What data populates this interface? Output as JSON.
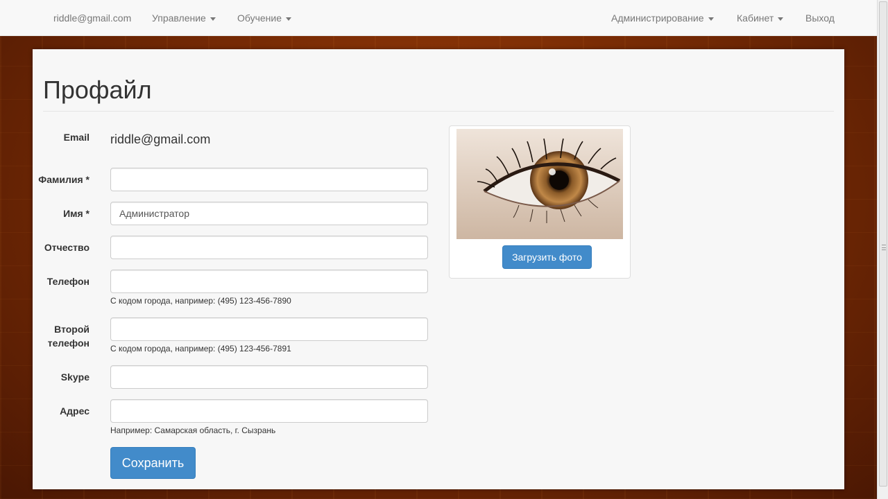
{
  "navbar": {
    "user_email": "riddle@gmail.com",
    "management": "Управление",
    "learning": "Обучение",
    "administration": "Администрирование",
    "cabinet": "Кабинет",
    "logout": "Выход"
  },
  "page": {
    "title": "Профайл"
  },
  "form": {
    "email_label": "Email",
    "email_value": "riddle@gmail.com",
    "last_name_label": "Фамилия *",
    "last_name_value": "",
    "first_name_label": "Имя *",
    "first_name_value": "Администратор",
    "middle_name_label": "Отчество",
    "middle_name_value": "",
    "phone_label": "Телефон",
    "phone_value": "",
    "phone_help": "С кодом города, например: (495) 123-456-7890",
    "phone2_label_line1": "Второй",
    "phone2_label_line2": "телефон",
    "phone2_value": "",
    "phone2_help": "С кодом города, например: (495) 123-456-7891",
    "skype_label": "Skype",
    "skype_value": "",
    "address_label": "Адрес",
    "address_value": "",
    "address_help": "Например: Самарская область, г. Сызрань",
    "save_label": "Сохранить"
  },
  "photo": {
    "upload_label": "Загрузить фото"
  },
  "colors": {
    "primary": "#428bca",
    "navbar_bg": "#f8f8f8",
    "panel_bg": "#f7f7f7"
  }
}
